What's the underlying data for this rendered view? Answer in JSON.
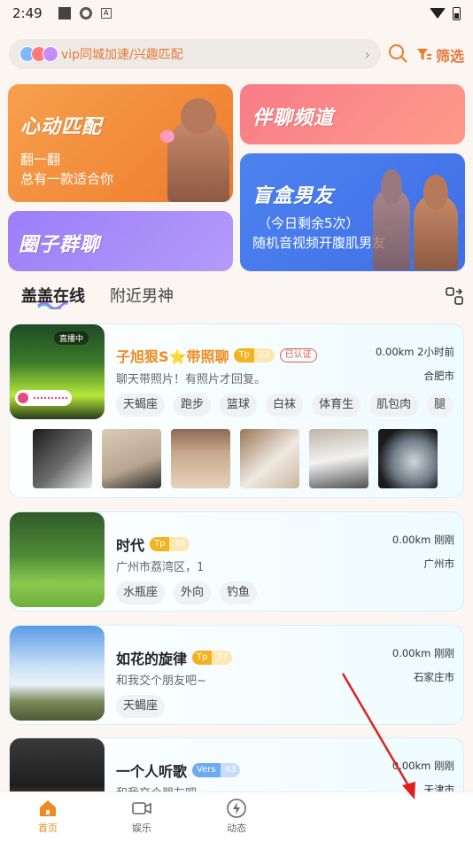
{
  "status": {
    "time": "2:49"
  },
  "search": {
    "text": "vip同城加速/兴趣匹配",
    "filter_label": "筛选"
  },
  "banners": {
    "heartbeat": {
      "title": "心动匹配",
      "line1": "翻一翻",
      "line2": "总有一款适合你"
    },
    "chat": {
      "title": "伴聊频道"
    },
    "group": {
      "title": "圈子群聊"
    },
    "blindbox": {
      "title": "盲盒男友",
      "line1": "（今日剩余5次）",
      "line2": "随机音视频开腹肌男友"
    }
  },
  "tabs": [
    {
      "label": "盖盖在线"
    },
    {
      "label": "附近男神"
    }
  ],
  "users": [
    {
      "name": "子旭狠S⭐带照聊",
      "level_key": "Tp",
      "level": "22",
      "certified": "已认证",
      "distance": "0.00km 2小时前",
      "city": "合肥市",
      "live": "直播中",
      "bio": "聊天带照片！有照片才回复。",
      "tags": [
        "天蝎座",
        "跑步",
        "篮球",
        "白袜",
        "体育生",
        "肌包肉",
        "腿"
      ]
    },
    {
      "name": "时代",
      "level_key": "Tp",
      "level": "38",
      "distance": "0.00km 刚刚",
      "city": "广州市",
      "bio": "广州市荔湾区，1",
      "tags": [
        "水瓶座",
        "外向",
        "钓鱼"
      ]
    },
    {
      "name": "如花的旋律",
      "level_key": "Tp",
      "level": "37",
      "distance": "0.00km 刚刚",
      "city": "石家庄市",
      "bio": "和我交个朋友吧~",
      "tags": [
        "天蝎座"
      ]
    },
    {
      "name": "一个人听歌",
      "level_key": "Vers",
      "level": "43",
      "distance": "0.00km 刚刚",
      "city": "天津市",
      "bio": "和我交个朋友吧~",
      "tags": []
    }
  ],
  "nav": [
    {
      "label": "首页"
    },
    {
      "label": "娱乐"
    },
    {
      "label": "动态"
    }
  ],
  "colors": {
    "accent": "#ee8a1f",
    "arrow": "#e02020"
  }
}
